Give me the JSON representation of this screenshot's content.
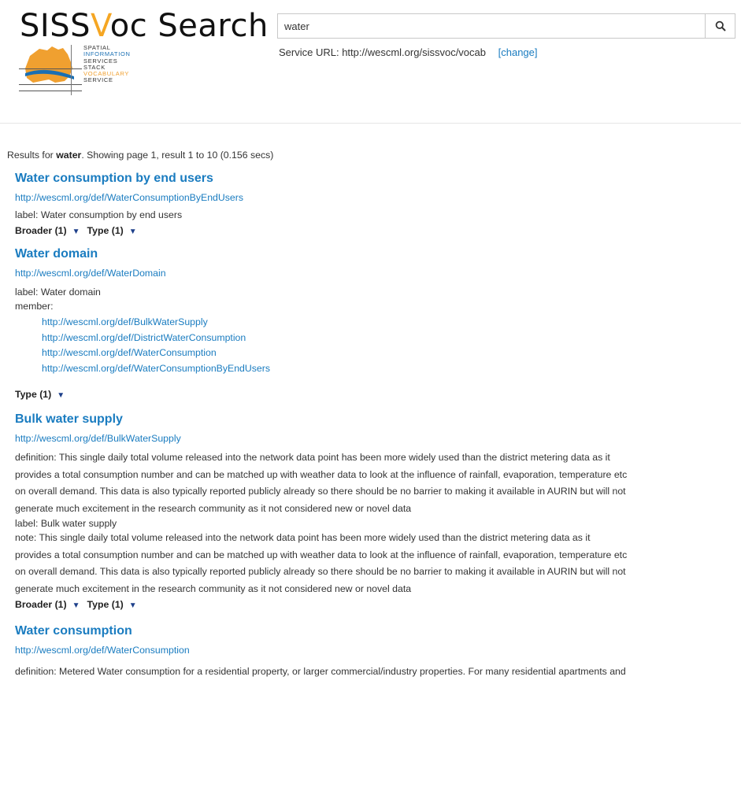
{
  "header": {
    "title_pre": "SISS",
    "title_hl": "V",
    "title_post": "oc Search",
    "logo_lines": [
      "SPATIAL",
      "INFORMATION",
      "SERVICES",
      "STACK",
      "VOCABULARY",
      "SERVICE"
    ]
  },
  "search": {
    "value": "water",
    "icon": "search-icon"
  },
  "service": {
    "label": "Service URL:",
    "url": "http://wescml.org/sissvoc/vocab",
    "change": "[change]"
  },
  "results": {
    "prefix": "Results for",
    "query": "water",
    "suffix": ". Showing page 1, result 1 to 10 (0.156 secs)",
    "items": [
      {
        "title": "Water consumption by end users",
        "uri": "http://wescml.org/def/WaterConsumptionByEndUsers",
        "label": "label: Water consumption by end users",
        "facets": [
          "Broader (1)",
          "Type (1)"
        ]
      },
      {
        "title": "Water domain",
        "uri": "http://wescml.org/def/WaterDomain",
        "label": "label: Water domain",
        "member_label": "member:",
        "members": [
          "http://wescml.org/def/BulkWaterSupply",
          "http://wescml.org/def/DistrictWaterConsumption",
          "http://wescml.org/def/WaterConsumption",
          "http://wescml.org/def/WaterConsumptionByEndUsers"
        ],
        "facets": [
          "Type (1)"
        ]
      },
      {
        "title": "Bulk water supply",
        "uri": "http://wescml.org/def/BulkWaterSupply",
        "definition": [
          "definition: This single daily total volume released into the network data point has been more widely used than the district metering data as it",
          "provides a total consumption number and can be matched up with weather data to look at the influence of rainfall, evaporation, temperature etc",
          "on overall demand. This data is also typically reported publicly already so there should be no barrier to making it available in AURIN but will not",
          "generate much excitement in the research community as it not considered new or novel data"
        ],
        "label": "label: Bulk water supply",
        "note": [
          "note: This single daily total volume released into the network data point has been more widely used than the district metering data as it",
          "provides a total consumption number and can be matched up with weather data to look at the influence of rainfall, evaporation, temperature etc",
          "on overall demand. This data is also typically reported publicly already so there should be no barrier to making it available in AURIN but will not",
          "generate much excitement in the research community as it not considered new or novel data"
        ],
        "facets": [
          "Broader (1)",
          "Type (1)"
        ]
      },
      {
        "title": "Water consumption",
        "uri": "http://wescml.org/def/WaterConsumption",
        "definition": [
          "definition: Metered Water consumption for a residential property, or larger commercial/industry properties. For many residential apartments and"
        ]
      }
    ]
  },
  "facet_arrow": "▼",
  "colors": {
    "link": "#1a7cc0",
    "accent": "#f5a623",
    "arrow": "#1d3f8a"
  }
}
